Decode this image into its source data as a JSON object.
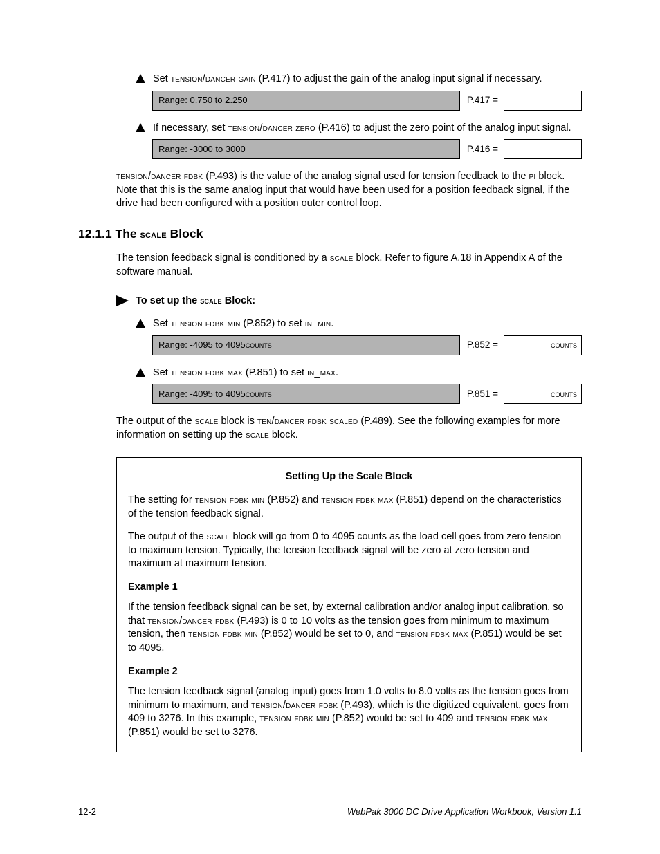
{
  "steps": {
    "s1": {
      "pre": "Set ",
      "param": "tension/dancer gain",
      "pnum": " (P.417) to adjust the gain of the analog input signal if necessary."
    },
    "bar1": {
      "range": "Range: 0.750 to 2.250",
      "label": "P.417 =",
      "unit": ""
    },
    "s2": {
      "pre": "If necessary, set ",
      "param": "tension/dancer zero",
      "pnum": " (P.416) to adjust the zero point of the analog input signal."
    },
    "bar2": {
      "range": "Range: -3000 to 3000",
      "label": "P.416 =",
      "unit": ""
    },
    "paraA": {
      "p1a": "tension/dancer fdbk",
      "p1b": " (P.493) is the value of the analog signal used for tension feedback to the ",
      "p1c": "pi",
      "p1d": " block. Note that this is the same analog input that would have been used for a position feedback signal, if the drive had been configured with a position outer control loop."
    }
  },
  "section": {
    "num": "12.1.1 The ",
    "sc": "scale",
    "tail": " Block",
    "para": {
      "a": "The tension feedback signal is conditioned by a ",
      "sc": "scale",
      "b": " block. Refer to figure A.18 in Appendix A of the software manual."
    },
    "toset": {
      "a": "To set up the ",
      "sc": "scale",
      "b": " Block:"
    },
    "s3": {
      "pre": "Set ",
      "param": "tension fdbk min",
      "mid": " (P.852) to set ",
      "tail": "in_min."
    },
    "bar3": {
      "range": "Range: -4095 to 4095 ",
      "range_sc": "counts",
      "label": "P.852 =",
      "unit": "counts"
    },
    "s4": {
      "pre": "Set ",
      "param": "tension fdbk max",
      "mid": " (P.851) to set ",
      "tail": "in_max."
    },
    "bar4": {
      "range": "Range: -4095 to 4095 ",
      "range_sc": "counts",
      "label": "P.851 =",
      "unit": "counts"
    },
    "paraB": {
      "a": "The output of the ",
      "sc1": "scale",
      "b": " block is ",
      "sc2": "ten/dancer fdbk scaled",
      "c": " (P.489). See the following examples for more information on setting up the ",
      "sc3": "scale",
      "d": " block."
    }
  },
  "box": {
    "title": "Setting Up the Scale Block",
    "p1": {
      "a": "The setting for ",
      "sc1": "tension fdbk min",
      "b": " (P.852) and ",
      "sc2": "tension fdbk max",
      "c": " (P.851) depend on the characteristics of the tension feedback signal."
    },
    "p2": {
      "a": "The output of the ",
      "sc1": "scale",
      "b": " block will go from 0 to 4095 counts as the load cell goes from zero tension to maximum tension. Typically, the tension feedback signal will be zero at zero tension and maximum at maximum tension."
    },
    "ex1h": "Example 1",
    "ex1": {
      "a": "If the tension feedback signal can be set, by external calibration and/or analog input calibration, so that ",
      "sc1": "tension/dancer fdbk",
      "b": " (P.493) is 0 to 10 volts as the tension goes from minimum to maximum tension, then ",
      "sc2": "tension fdbk min",
      "c": " (P.852) would be set to 0, and ",
      "sc3": "tension fdbk max",
      "d": " (P.851) would be set to 4095."
    },
    "ex2h": "Example 2",
    "ex2": {
      "a": "The tension feedback signal (analog input) goes from 1.0 volts to 8.0 volts as the tension goes from minimum to maximum, and ",
      "sc1": "tension/dancer fdbk",
      "b": " (P.493), which is the digitized equivalent, goes from 409 to 3276. In this example, ",
      "sc2": "tension fdbk min",
      "c": " (P.852) would be set to 409 and ",
      "sc3": "tension fdbk max",
      "d": " (P.851) would be set to 3276."
    }
  },
  "footer": {
    "page": "12-2",
    "doc": "WebPak 3000 DC Drive Application Workbook, Version 1.1"
  }
}
